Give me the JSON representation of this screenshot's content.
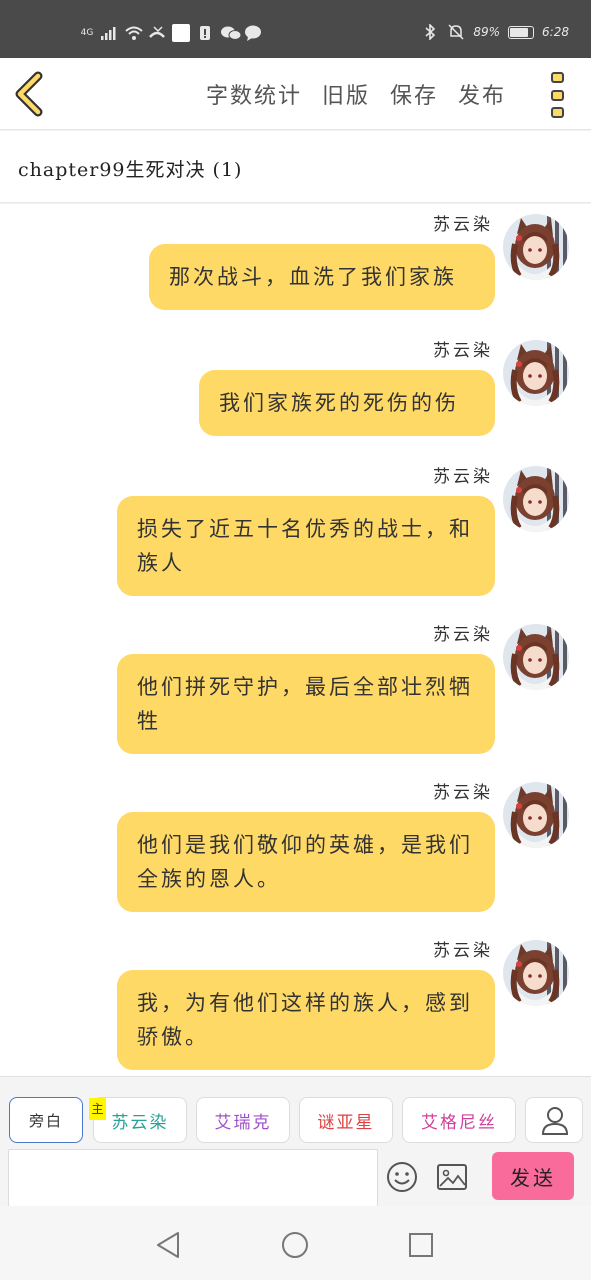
{
  "status_bar": {
    "network": "4G",
    "battery_text": "89%",
    "battery_level": 0.89,
    "time": "6:28"
  },
  "header": {
    "actions": [
      "字数统计",
      "旧版",
      "保存",
      "发布"
    ],
    "accent_color": "#ffd966"
  },
  "chapter": {
    "title": "chapter99生死对决 (1)"
  },
  "messages": [
    {
      "sender": "苏云染",
      "text": "那次战斗，血洗了我们家族"
    },
    {
      "sender": "苏云染",
      "text": "我们家族死的死伤的伤"
    },
    {
      "sender": "苏云染",
      "text": "损失了近五十名优秀的战士，和族人"
    },
    {
      "sender": "苏云染",
      "text": "他们拼死守护，最后全部壮烈牺牲"
    },
    {
      "sender": "苏云染",
      "text": "他们是我们敬仰的英雄，是我们全族的恩人。"
    },
    {
      "sender": "苏云染",
      "text": "我，为有他们这样的族人，感到骄傲。"
    }
  ],
  "toolbar": {
    "roles": [
      {
        "label": "旁白",
        "color": "#333333"
      },
      {
        "label": "苏云染",
        "color": "#2aa198",
        "tag": "主"
      },
      {
        "label": "艾瑞克",
        "color": "#a050c8"
      },
      {
        "label": "谜亚星",
        "color": "#e04040"
      },
      {
        "label": "艾格尼丝",
        "color": "#d0409a"
      }
    ],
    "input_value": "",
    "send_label": "发送",
    "send_color": "#f96b9b"
  },
  "icons": {
    "back": "chevron-left-icon",
    "more": "more-vertical-icon",
    "character": "person-icon",
    "emoji": "smiley-icon",
    "image": "image-icon"
  }
}
